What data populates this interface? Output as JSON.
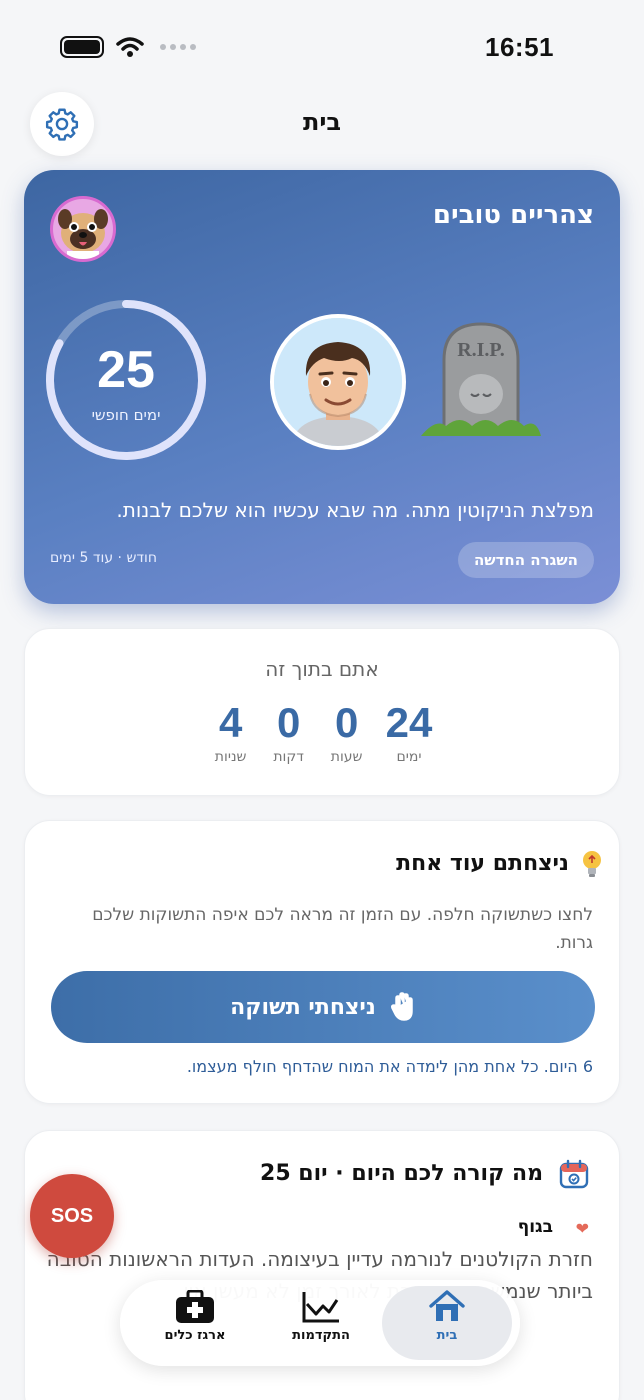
{
  "status_bar": {
    "time": "16:51"
  },
  "header": {
    "title": "בית"
  },
  "hero": {
    "greeting": "צהריים טובים",
    "days_count": "25",
    "days_label": "ימים חופשי",
    "progress_fraction": 0.83,
    "message": "מפלצת הניקוטין מתה. מה שבא עכשיו הוא שלכם לבנות.",
    "phase_label": "השגרה החדשה",
    "phase_meta": "חודש · עוד 5 ימים",
    "tombstone_text": "R.I.P."
  },
  "timer": {
    "title": "אתם בתוך זה",
    "units": [
      {
        "value": "24",
        "label": "ימים"
      },
      {
        "value": "0",
        "label": "שעות"
      },
      {
        "value": "0",
        "label": "דקות"
      },
      {
        "value": "4",
        "label": "שניות"
      }
    ]
  },
  "craving": {
    "title": "ניצחתם עוד אחת",
    "description": "לחצו כשתשוקה חלפה. עם הזמן זה מראה לכם איפה התשוקות שלכם גרות.",
    "button_label": "ניצחתי תשוקה",
    "footer": "6 היום. כל אחת מהן לימדה את המוח שהדחף חולף מעצמו."
  },
  "today": {
    "title": "מה קורה לכם היום · יום 25",
    "section_label": "בגוף",
    "text": "חזרת הקולטנים לנורמה עדיין בעיצומה. העדות הראשונות הטובה ביותר שנמשכת שנמשכת לאורך זמן לא מעשן אין"
  },
  "sos": {
    "label": "SOS"
  },
  "nav": {
    "home": "בית",
    "progress": "התקדמות",
    "toolkit": "ארגז כלים"
  },
  "colors": {
    "accent": "#3a6aa5",
    "sos": "#cf4a3e"
  }
}
